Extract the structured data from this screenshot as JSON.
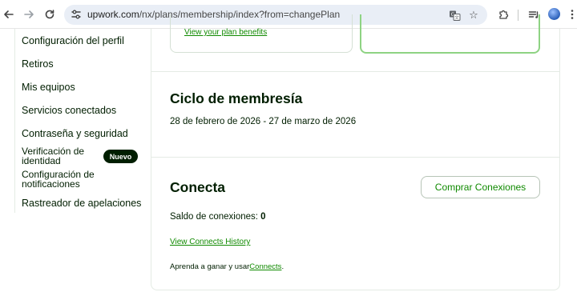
{
  "browser": {
    "url_host": "upwork.com",
    "url_path": "/nx/plans/membership/index?from=changePlan",
    "icons": [
      "back-arrow-icon",
      "forward-arrow-icon",
      "reload-icon",
      "site-settings-icon",
      "translate-icon",
      "bookmark-star-icon",
      "extensions-icon",
      "reading-list-icon",
      "profile-avatar-icon",
      "menu-dots-icon"
    ]
  },
  "sidebar": {
    "items": [
      {
        "label": "Configuración del perfil"
      },
      {
        "label": "Retiros"
      },
      {
        "label": "Mis equipos"
      },
      {
        "label": "Servicios conectados"
      },
      {
        "label": "Contraseña y seguridad"
      },
      {
        "label_line1": "Verificación de",
        "label_line2": "identidad",
        "badge": "Nuevo"
      },
      {
        "label_line1": "Configuración de",
        "label_line2": "notificaciones"
      },
      {
        "label": "Rastreador de apelaciones"
      }
    ]
  },
  "plan": {
    "benefits_link": "View your plan benefits"
  },
  "membership_cycle": {
    "title": "Ciclo de membresía",
    "dates": "28 de febrero de 2026 - 27 de marzo de 2026"
  },
  "connects": {
    "title": "Conecta",
    "buy_button": "Comprar Conexiones",
    "balance_label": "Saldo de conexiones: ",
    "balance_value": "0",
    "history_link": "View Connects History",
    "learn_prefix": "Aprenda a ganar y usar",
    "learn_link": "Connects",
    "learn_suffix": "."
  },
  "colors": {
    "brand_green": "#108a00",
    "text_dark": "#001e00",
    "badge_bg": "#001e00",
    "highlight_border": "#8ed383"
  }
}
